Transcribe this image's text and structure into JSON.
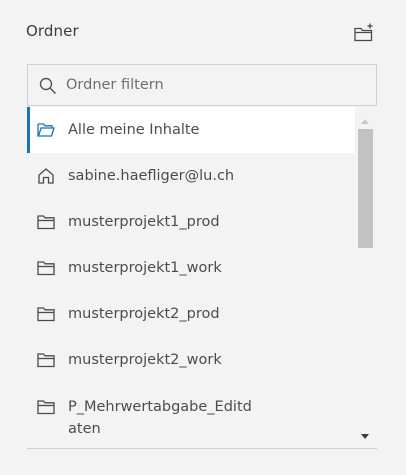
{
  "header": {
    "title": "Ordner",
    "new_folder_icon": "folder-plus-icon"
  },
  "search": {
    "placeholder": "Ordner filtern",
    "value": "",
    "icon": "search-icon"
  },
  "folders": [
    {
      "label": "Alle meine Inhalte",
      "icon": "folder-open-icon",
      "selected": true
    },
    {
      "label": "sabine.haefliger@lu.ch",
      "icon": "home-icon"
    },
    {
      "label": "musterprojekt1_prod",
      "icon": "folder-icon"
    },
    {
      "label": "musterprojekt1_work",
      "icon": "folder-icon"
    },
    {
      "label": "musterprojekt2_prod",
      "icon": "folder-icon"
    },
    {
      "label": "musterprojekt2_work",
      "icon": "folder-icon"
    },
    {
      "label": "P_Mehrwertabgabe_Editd",
      "label_line2": "aten",
      "icon": "folder-icon"
    }
  ],
  "colors": {
    "accent": "#1a73b8",
    "selected_bg": "#ffffff",
    "panel_bg": "#f3f3f3"
  }
}
